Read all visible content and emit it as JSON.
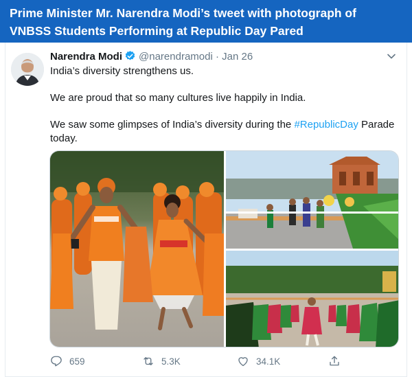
{
  "banner": {
    "line1": "Prime Minister Mr. Narendra Modi’s tweet with photograph of",
    "line2": "VNBSS Students Performing at Republic Day Pared"
  },
  "tweet": {
    "author_name": "Narendra Modi",
    "handle": "@narendramodi",
    "separator": "·",
    "date": "Jan 26",
    "line1": "India’s diversity strengthens us.",
    "line2": "We are proud that so many cultures live happily in India.",
    "line3_before": "We saw some glimpses of India’s diversity during the ",
    "hashtag": "#RepublicDay",
    "line3_after": " Parade",
    "line4": "today."
  },
  "actions": {
    "replies": "659",
    "retweets": "5.3K",
    "likes": "34.1K"
  },
  "icons": [
    "verified-badge-icon",
    "chevron-down-icon",
    "reply-icon",
    "retweet-icon",
    "like-icon",
    "share-icon"
  ],
  "colors": {
    "banner": "#1565c0",
    "link": "#1da1f2",
    "muted": "#657786",
    "text": "#14171a"
  }
}
